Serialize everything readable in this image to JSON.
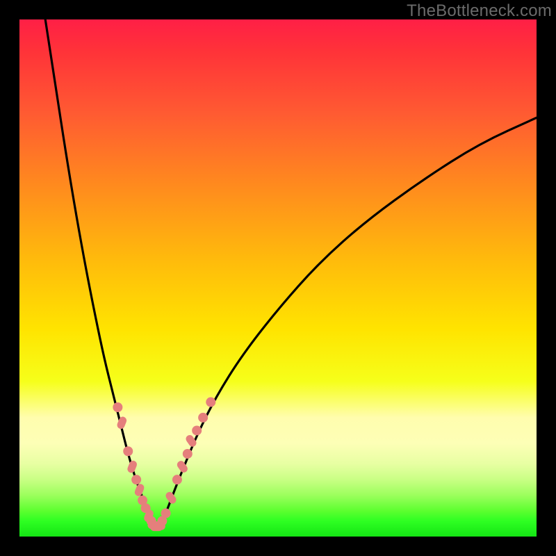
{
  "watermark_text": "TheBottleneck.com",
  "colors": {
    "page_bg": "#000000",
    "curve": "#000000",
    "marker": "#e57f7c",
    "gradient_top": "#ff1f46",
    "gradient_bottom": "#14e514",
    "watermark": "#6b6b6b"
  },
  "chart_data": {
    "type": "line",
    "title": "",
    "xlabel": "",
    "ylabel": "",
    "xlim": [
      0,
      100
    ],
    "ylim": [
      0,
      100
    ],
    "grid": false,
    "legend": false,
    "annotations": [
      "TheBottleneck.com"
    ],
    "series": [
      {
        "name": "left-curve",
        "x": [
          5,
          7,
          9,
          11,
          13,
          15,
          16.5,
          18,
          19.5,
          21,
          22.5,
          24,
          25,
          25.7
        ],
        "y": [
          100,
          87,
          74,
          62,
          51,
          41,
          34,
          28,
          22,
          16,
          11,
          7,
          4,
          2
        ]
      },
      {
        "name": "right-curve",
        "x": [
          27.3,
          28.5,
          30,
          32,
          34.5,
          38,
          43,
          50,
          58,
          67,
          78,
          89,
          100
        ],
        "y": [
          2,
          5,
          9,
          14,
          20,
          27,
          35,
          44,
          53,
          61,
          69,
          76,
          81
        ]
      },
      {
        "name": "valley-floor",
        "x": [
          25.7,
          26.5,
          27.3
        ],
        "y": [
          2,
          1.5,
          2
        ]
      }
    ],
    "markers_left": [
      {
        "x": 19.0,
        "y": 25.0,
        "shape": "circle"
      },
      {
        "x": 19.8,
        "y": 22.0,
        "shape": "capsule"
      },
      {
        "x": 21.0,
        "y": 16.5,
        "shape": "circle"
      },
      {
        "x": 21.8,
        "y": 13.5,
        "shape": "capsule"
      },
      {
        "x": 22.6,
        "y": 11.0,
        "shape": "circle"
      },
      {
        "x": 23.2,
        "y": 9.0,
        "shape": "capsule"
      },
      {
        "x": 23.8,
        "y": 7.0,
        "shape": "circle"
      },
      {
        "x": 24.4,
        "y": 5.5,
        "shape": "circle"
      },
      {
        "x": 25.0,
        "y": 4.0,
        "shape": "capsule"
      },
      {
        "x": 25.5,
        "y": 3.0,
        "shape": "circle"
      }
    ],
    "markers_valley": [
      {
        "x": 26.0,
        "y": 2.2,
        "shape": "capsule"
      },
      {
        "x": 26.5,
        "y": 1.8,
        "shape": "capsule"
      },
      {
        "x": 27.0,
        "y": 2.0,
        "shape": "capsule"
      }
    ],
    "markers_right": [
      {
        "x": 27.6,
        "y": 3.0,
        "shape": "circle"
      },
      {
        "x": 28.3,
        "y": 4.5,
        "shape": "circle"
      },
      {
        "x": 29.3,
        "y": 7.5,
        "shape": "capsule"
      },
      {
        "x": 30.5,
        "y": 11.0,
        "shape": "circle"
      },
      {
        "x": 31.5,
        "y": 13.5,
        "shape": "capsule"
      },
      {
        "x": 32.5,
        "y": 16.0,
        "shape": "circle"
      },
      {
        "x": 33.2,
        "y": 18.5,
        "shape": "capsule"
      },
      {
        "x": 34.3,
        "y": 20.5,
        "shape": "circle"
      },
      {
        "x": 35.5,
        "y": 23.0,
        "shape": "circle"
      },
      {
        "x": 37.0,
        "y": 26.0,
        "shape": "circle"
      }
    ]
  }
}
